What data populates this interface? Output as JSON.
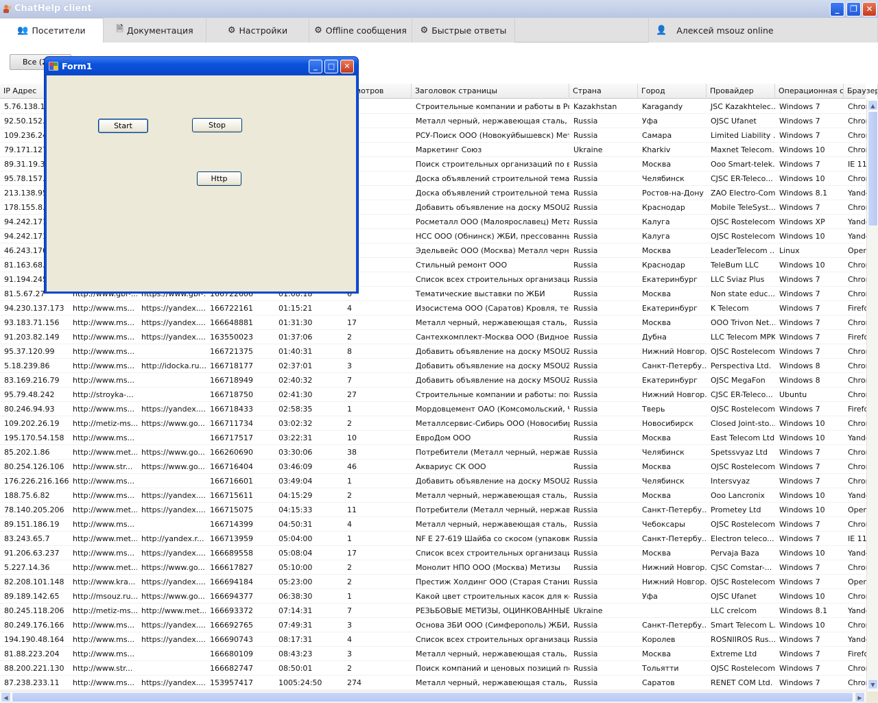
{
  "window": {
    "title": "ChatHelp client"
  },
  "tabs": [
    {
      "label": "Посетители",
      "icon": "users-icon"
    },
    {
      "label": "Документация",
      "icon": "document-icon"
    },
    {
      "label": "Настройки",
      "icon": "gear-icon"
    },
    {
      "label": "Offline сообщения",
      "icon": "gear-icon"
    },
    {
      "label": "Быстрые ответы",
      "icon": "gear-icon"
    }
  ],
  "user": {
    "label": "Алексей msouz online",
    "icon": "user-icon"
  },
  "filter": {
    "label": "Все (2"
  },
  "dialog": {
    "title": "Form1",
    "start": "Start",
    "stop": "Stop",
    "http": "Http"
  },
  "grid": {
    "headers": [
      "IP Адрес",
      "",
      "",
      "",
      "",
      "осмотров",
      "Заголовок страницы",
      "Страна",
      "Город",
      "Провайдер",
      "Операционная сис",
      "Браузер"
    ],
    "rows": [
      [
        "5.76.138.18",
        "",
        "",
        "",
        "",
        "",
        "Строительные компании и работы в Рос...",
        "Kazakhstan",
        "Karagandy",
        "JSC Kazakhtelec...",
        "Windows 7",
        "Chron"
      ],
      [
        "92.50.152.1",
        "",
        "",
        "",
        "",
        "",
        "Металл черный, нержавеющая сталь, т...",
        "Russia",
        "Уфа",
        "OJSC Ufanet",
        "Windows 7",
        "Chron"
      ],
      [
        "109.236.24",
        "",
        "",
        "",
        "",
        "",
        "РСУ-Поиск ООО (Новокуйбышевск) Мет...",
        "Russia",
        "Самара",
        "Limited Liability ...",
        "Windows 7",
        "Chron"
      ],
      [
        "79.171.127",
        "",
        "",
        "",
        "",
        "",
        "Маркетинг Союз",
        "Ukraine",
        "Kharkiv",
        "Maxnet Telecom...",
        "Windows 10",
        "Chron"
      ],
      [
        "89.31.19.37",
        "",
        "",
        "",
        "",
        "",
        "Поиск строительных организаций по ви...",
        "Russia",
        "Москва",
        "Ooo Smart-telek...",
        "Windows 7",
        "IE 11"
      ],
      [
        "95.78.157.2",
        "",
        "",
        "",
        "",
        "",
        "Доска объявлений строительной темати...",
        "Russia",
        "Челябинск",
        "CJSC ER-Teleco...",
        "Windows 10",
        "Chron"
      ],
      [
        "213.138.95",
        "",
        "",
        "",
        "",
        "",
        "Доска объявлений строительной темати...",
        "Russia",
        "Ростов-на-Дону",
        "ZAO Electro-Com",
        "Windows 8.1",
        "Yande"
      ],
      [
        "178.155.8.2",
        "",
        "",
        "",
        "",
        "",
        "Добавить объявление на доску MSOUZ.RU",
        "Russia",
        "Краснодар",
        "Mobile TeleSyst...",
        "Windows 7",
        "Chron"
      ],
      [
        "94.242.171",
        "",
        "",
        "",
        "",
        "",
        "Росметалл ООО (Малоярославец) Метал...",
        "Russia",
        "Калуга",
        "OJSC Rostelecom",
        "Windows XP",
        "Yande"
      ],
      [
        "94.242.171",
        "",
        "",
        "",
        "",
        "",
        "НСС ООО (Обнинск) ЖБИ, прессованные...",
        "Russia",
        "Калуга",
        "OJSC Rostelecom",
        "Windows 10",
        "Yande"
      ],
      [
        "46.243.170",
        "",
        "",
        "",
        "",
        "",
        "Эдельвейс ООО (Москва) Металл черны...",
        "Russia",
        "Москва",
        "LeaderTelecom ...",
        "Linux",
        "Opera"
      ],
      [
        "81.163.68.9",
        "",
        "",
        "",
        "",
        "",
        "Стильный ремонт ООО",
        "Russia",
        "Краснодар",
        "TeleBum LLC",
        "Windows 10",
        "Chron"
      ],
      [
        "91.194.245",
        "",
        "",
        "",
        "",
        "",
        "Список всех строительных организаций ...",
        "Russia",
        "Екатеринбург",
        "LLC Sviaz Plus",
        "Windows 7",
        "Chron"
      ],
      [
        "81.5.67.27",
        "http://www.gbr-...",
        "https://www.gbr-...",
        "166722606",
        "01:08:18",
        "6",
        "Тематические выставки по ЖБИ",
        "Russia",
        "Москва",
        "Non state educ...",
        "Windows 7",
        "Chron"
      ],
      [
        "94.230.137.173",
        "http://www.ms...",
        "https://yandex....",
        "166722161",
        "01:15:21",
        "4",
        "Изосистема ООО (Саратов) Кровля, теп...",
        "Russia",
        "Екатеринбург",
        "K Telecom",
        "Windows 7",
        "Firefo"
      ],
      [
        "93.183.71.156",
        "http://www.ms...",
        "https://yandex....",
        "166648881",
        "01:31:30",
        "17",
        "Металл черный, нержавеющая сталь, т...",
        "Russia",
        "Москва",
        "OOO Trivon Net...",
        "Windows 7",
        "Chron"
      ],
      [
        "91.203.82.149",
        "http://www.ms...",
        "https://yandex....",
        "163550023",
        "01:37:06",
        "2",
        "Сантехкомплект-Москва ООО (Видное, ...",
        "Russia",
        "Дубна",
        "LLC Telecom MPK",
        "Windows 7",
        "Firefo"
      ],
      [
        "95.37.120.99",
        "http://www.ms...",
        "",
        "166721375",
        "01:40:31",
        "8",
        "Добавить объявление на доску MSOUZ.RU",
        "Russia",
        "Нижний Новгор...",
        "OJSC Rostelecom",
        "Windows 7",
        "Chron"
      ],
      [
        "5.18.239.86",
        "http://www.ms...",
        "http://idocka.ru....",
        "166718177",
        "02:37:01",
        "3",
        "Добавить объявление на доску MSOUZ.RU",
        "Russia",
        "Санкт-Петербу...",
        "Perspectiva Ltd.",
        "Windows 8",
        "Chron"
      ],
      [
        "83.169.216.79",
        "http://www.ms...",
        "",
        "166718949",
        "02:40:32",
        "7",
        "Добавить объявление на доску MSOUZ.RU",
        "Russia",
        "Екатеринбург",
        "OJSC MegaFon",
        "Windows 8",
        "Chron"
      ],
      [
        "95.79.48.242",
        "http://stroyka-...",
        "",
        "166718750",
        "02:41:30",
        "27",
        "Строительные компании и работы: поис...",
        "Russia",
        "Нижний Новгор...",
        "CJSC ER-Teleco...",
        "Ubuntu",
        "Chron"
      ],
      [
        "80.246.94.93",
        "http://www.ms...",
        "https://yandex....",
        "166718433",
        "02:58:35",
        "1",
        "Мордовцемент ОАО (Комсомольский, Ча...",
        "Russia",
        "Тверь",
        "OJSC Rostelecom",
        "Windows 7",
        "Firefo"
      ],
      [
        "109.202.26.19",
        "http://metiz-ms...",
        "https://www.go...",
        "166711734",
        "03:02:32",
        "2",
        "Металлсервис-Сибирь ООО (Новосибирс...",
        "Russia",
        "Новосибирск",
        "Closed Joint-sto...",
        "Windows 10",
        "Chron"
      ],
      [
        "195.170.54.158",
        "http://www.ms...",
        "",
        "166717517",
        "03:22:31",
        "10",
        "ЕвроДом ООО",
        "Russia",
        "Москва",
        "East Telecom Ltd.",
        "Windows 10",
        "Yande"
      ],
      [
        "85.202.1.86",
        "http://www.met...",
        "https://www.go...",
        "166260690",
        "03:30:06",
        "38",
        "Потребители (Металл черный, нержаве...",
        "Russia",
        "Челябинск",
        "Spetssvyaz Ltd",
        "Windows 7",
        "Chron"
      ],
      [
        "80.254.126.106",
        "http://www.str...",
        "https://www.go...",
        "166716404",
        "03:46:09",
        "46",
        "Аквариус СК ООО",
        "Russia",
        "Москва",
        "OJSC Rostelecom",
        "Windows 7",
        "Chron"
      ],
      [
        "176.226.216.166",
        "http://www.ms...",
        "",
        "166716601",
        "03:49:04",
        "1",
        "Добавить объявление на доску MSOUZ.RU",
        "Russia",
        "Челябинск",
        "Intersvyaz",
        "Windows 7",
        "Chron"
      ],
      [
        "188.75.6.82",
        "http://www.ms...",
        "https://yandex....",
        "166715611",
        "04:15:29",
        "2",
        "Металл черный, нержавеющая сталь, т...",
        "Russia",
        "Москва",
        "Ooo Lancronix",
        "Windows 10",
        "Yande"
      ],
      [
        "78.140.205.206",
        "http://www.met...",
        "https://yandex....",
        "166715075",
        "04:15:33",
        "11",
        "Потребители (Металл черный, нержаве...",
        "Russia",
        "Санкт-Петербу...",
        "Prometey Ltd",
        "Windows 10",
        "Opera"
      ],
      [
        "89.151.186.19",
        "http://www.ms...",
        "",
        "166714399",
        "04:50:31",
        "4",
        "Металл черный, нержавеющая сталь, т...",
        "Russia",
        "Чебоксары",
        "OJSC Rostelecom",
        "Windows 7",
        "Chron"
      ],
      [
        "83.243.65.7",
        "http://www.met...",
        "http://yandex.r...",
        "166713959",
        "05:04:00",
        "1",
        "NF E 27-619 Шайба со скосом (упаковка ...",
        "Russia",
        "Санкт-Петербу...",
        "Electron teleco...",
        "Windows 7",
        "IE 11"
      ],
      [
        "91.206.63.237",
        "http://www.ms...",
        "https://yandex....",
        "166689558",
        "05:08:04",
        "17",
        "Список всех строительных организаций ...",
        "Russia",
        "Москва",
        "Pervaja Baza",
        "Windows 10",
        "Yande"
      ],
      [
        "5.227.14.36",
        "http://www.met...",
        "https://www.go...",
        "166617827",
        "05:10:00",
        "2",
        "Монолит НПО ООО (Москва) Метизы",
        "Russia",
        "Нижний Новгор...",
        "CJSC Comstar-...",
        "Windows 7",
        "Chron"
      ],
      [
        "82.208.101.148",
        "http://www.kra...",
        "https://yandex....",
        "166694184",
        "05:23:00",
        "2",
        "Престиж Холдинг ООО (Старая Станица...",
        "Russia",
        "Нижний Новгор...",
        "OJSC Rostelecom",
        "Windows 7",
        "Opera"
      ],
      [
        "89.189.142.65",
        "http://msouz.ru...",
        "https://www.go...",
        "166694377",
        "06:38:30",
        "1",
        "Какой цвет строительных касок для ког...",
        "Russia",
        "Уфа",
        "OJSC Ufanet",
        "Windows 10",
        "Chron"
      ],
      [
        "80.245.118.206",
        "http://metiz-ms...",
        "http://www.met...",
        "166693372",
        "07:14:31",
        "7",
        "РЕЗЬБОВЫЕ МЕТИЗЫ, ОЦИНКОВАННЫЕ Т...",
        "Ukraine",
        "",
        "LLC crelcom",
        "Windows 8.1",
        "Yande"
      ],
      [
        "80.249.176.166",
        "http://www.ms...",
        "https://yandex....",
        "166692765",
        "07:49:31",
        "3",
        "Основа ЗБИ ООО (Симферополь) ЖБИ, п...",
        "Russia",
        "Санкт-Петербу...",
        "Smart Telecom L...",
        "Windows 10",
        "Chron"
      ],
      [
        "194.190.48.164",
        "http://www.ms...",
        "https://yandex....",
        "166690743",
        "08:17:31",
        "4",
        "Список всех строительных организаций ...",
        "Russia",
        "Королев",
        "ROSNIIROS Rus...",
        "Windows 7",
        "Yande"
      ],
      [
        "81.88.223.204",
        "http://www.ms...",
        "",
        "166680109",
        "08:43:23",
        "3",
        "Металл черный, нержавеющая сталь, т...",
        "Russia",
        "Москва",
        "Extreme Ltd",
        "Windows 7",
        "Firefo"
      ],
      [
        "88.200.221.130",
        "http://www.str...",
        "",
        "166682747",
        "08:50:01",
        "2",
        "Поиск компаний и ценовых позиций по б...",
        "Russia",
        "Тольятти",
        "OJSC Rostelecom",
        "Windows 7",
        "Chron"
      ],
      [
        "87.238.233.11",
        "http://www.ms...",
        "https://yandex....",
        "153957417",
        "1005:24:50",
        "274",
        "Металл черный, нержавеющая сталь, т...",
        "Russia",
        "Саратов",
        "RENET COM Ltd.",
        "Windows 7",
        "Chron"
      ]
    ]
  }
}
